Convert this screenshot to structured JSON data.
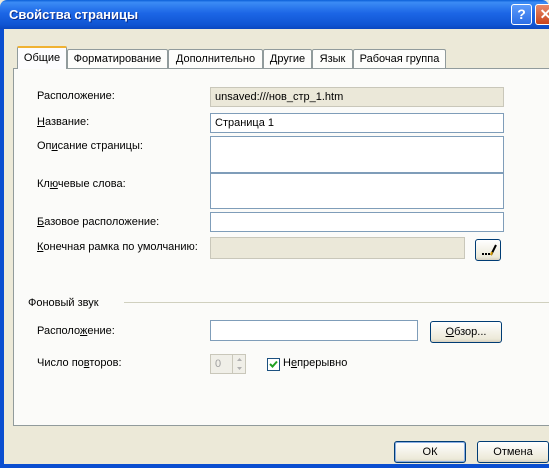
{
  "window": {
    "title": "Свойства страницы",
    "help_glyph": "?",
    "close_glyph": "✕"
  },
  "tabs": [
    {
      "label": "Общие",
      "active": true
    },
    {
      "label": "Форматирование"
    },
    {
      "label": "Дополнительно"
    },
    {
      "label": "Другие"
    },
    {
      "label": "Язык"
    },
    {
      "label": "Рабочая группа"
    }
  ],
  "general": {
    "location": {
      "label": "Расположение:",
      "value": "unsaved:///нов_стр_1.htm"
    },
    "name": {
      "label_pre": "",
      "label_u": "Н",
      "label_post": "азвание:",
      "value": "Страница 1"
    },
    "description": {
      "label_pre": "Оп",
      "label_u": "и",
      "label_post": "сание страницы:",
      "value": ""
    },
    "keywords": {
      "label_pre": "Кл",
      "label_u": "ю",
      "label_post": "чевые слова:",
      "value": ""
    },
    "base_location": {
      "label_pre": "",
      "label_u": "Б",
      "label_post": "азовое расположение:",
      "value": ""
    },
    "default_target": {
      "label_pre": "",
      "label_u": "К",
      "label_post": "онечная рамка по умолчанию:",
      "value": ""
    }
  },
  "background_sound": {
    "group_label": "Фоновый звук",
    "location": {
      "label_pre": "Располо",
      "label_u": "ж",
      "label_post": "ение:",
      "value": ""
    },
    "browse": {
      "label_u": "О",
      "label_post": "бзор..."
    },
    "loop": {
      "label_pre": "Число по",
      "label_u": "в",
      "label_post": "торов:",
      "value": "0"
    },
    "forever": {
      "label_pre": "Н",
      "label_u": "е",
      "label_post": "прерывно",
      "checked": true
    }
  },
  "footer": {
    "ok": "ОК",
    "cancel": "Отмена"
  }
}
